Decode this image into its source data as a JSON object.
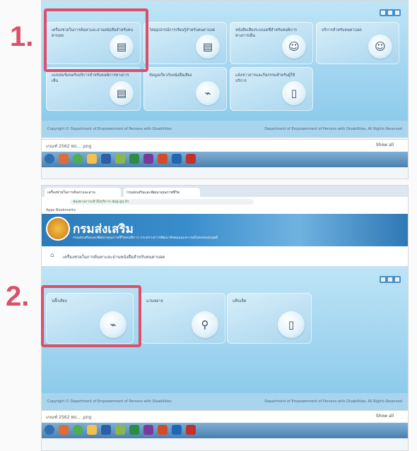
{
  "steps": {
    "one": "1.",
    "two": "2."
  },
  "shot1": {
    "tiles": [
      {
        "label": "เครื่องช่วยในการค้นหาและอ่านหนังสือสำหรับคนตาบอด"
      },
      {
        "label": "วัสดุอุปกรณ์การเรียนรู้สำหรับคนตาบอด"
      },
      {
        "label": "หนังสือเสียงระบบเดซี่สำหรับคนพิการทางการเห็น"
      },
      {
        "label": "บริการสำหรับคนตาบอด"
      },
      {
        "label": "แบบฟอร์มขอรับบริการสำหรับคนพิการทางการเห็น"
      },
      {
        "label": "ข้อมูลเกี่ยวกับหนังสือเสียง"
      },
      {
        "label": "แจ้งข่าวสารและกิจกรรมสำหรับผู้ใช้บริการ"
      }
    ],
    "footer_left": "Copyright © Department of Empowerment of Persons with Disabilities",
    "footer_right": "Department of Empowerment of Persons with Disabilities, All Rights Reserved",
    "download_file": "เกณฑ์ 2562 ฟป... .png",
    "show_all": "Show all"
  },
  "shot2": {
    "tab1": "เครื่องช่วยในการค้นหาและอ่าน",
    "tab2": "กรมส่งเสริมและพัฒนาคุณภาพชีวิต",
    "url": "ช่องทางการเข้าถึงบริการ dep.go.th",
    "bookmarks": "Apps   Bookmarks",
    "brand": "กรมส่งเสริม",
    "subtitle": "กรมส่งเสริมและพัฒนาคุณภาพชีวิตคนพิการ กระทรวงการพัฒนาสังคมและความมั่นคงของมนุษย์",
    "breadcrumb": "เครื่องช่วยในการค้นหาและอ่านหนังสือสำหรับคนตาบอด",
    "tiles": [
      {
        "label": "ปลั๊กเสียบ"
      },
      {
        "label": "แว่นขยาย"
      },
      {
        "label": "แท็บเล็ต"
      }
    ],
    "footer_left": "Copyright © Department of Empowerment of Persons with Disabilities",
    "footer_right": "Department of Empowerment of Persons with Disabilities, All Rights Reserved",
    "download_file": "เกณฑ์ 2562 ฟป... .png",
    "show_all": "Show all"
  },
  "icons": {
    "usb": "⌁",
    "magnifier": "⚲",
    "tablet": "▯",
    "book": "▤",
    "person": "☺"
  },
  "colors": {
    "highlight": "#d9506a",
    "accent": "#4a90c8"
  }
}
